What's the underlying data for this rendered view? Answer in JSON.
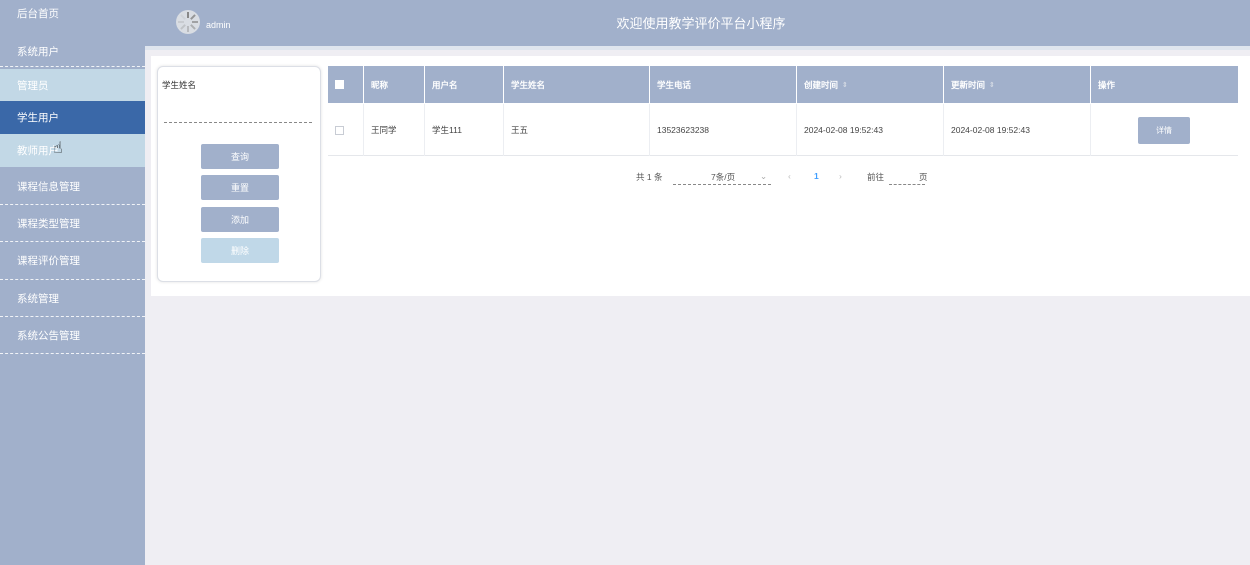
{
  "sidebar": {
    "items": [
      {
        "label": "后台首页"
      },
      {
        "label": "系统用户"
      },
      {
        "label": "管理员"
      },
      {
        "label": "学生用户"
      },
      {
        "label": "教师用户"
      },
      {
        "label": "课程信息管理"
      },
      {
        "label": "课程类型管理"
      },
      {
        "label": "课程评价管理"
      },
      {
        "label": "系统管理"
      },
      {
        "label": "系统公告管理"
      }
    ]
  },
  "header": {
    "username": "admin",
    "welcome": "欢迎使用教学评价平台小程序"
  },
  "search": {
    "label": "学生姓名",
    "value": "",
    "buttons": {
      "query": "查询",
      "reset": "重置",
      "add": "添加",
      "delete": "删除"
    }
  },
  "table": {
    "columns": [
      "昵称",
      "用户名",
      "学生姓名",
      "学生电话",
      "创建时间",
      "更新时间",
      "操作"
    ],
    "rows": [
      {
        "nickname": "王同学",
        "username": "学生111",
        "student_name": "王五",
        "phone": "13523623238",
        "created": "2024-02-08 19:52:43",
        "updated": "2024-02-08 19:52:43",
        "action": "详情"
      }
    ]
  },
  "pagination": {
    "total": "共 1 条",
    "page_size": "7条/页",
    "current_page": "1",
    "goto_label": "前往",
    "page_unit": "页"
  }
}
